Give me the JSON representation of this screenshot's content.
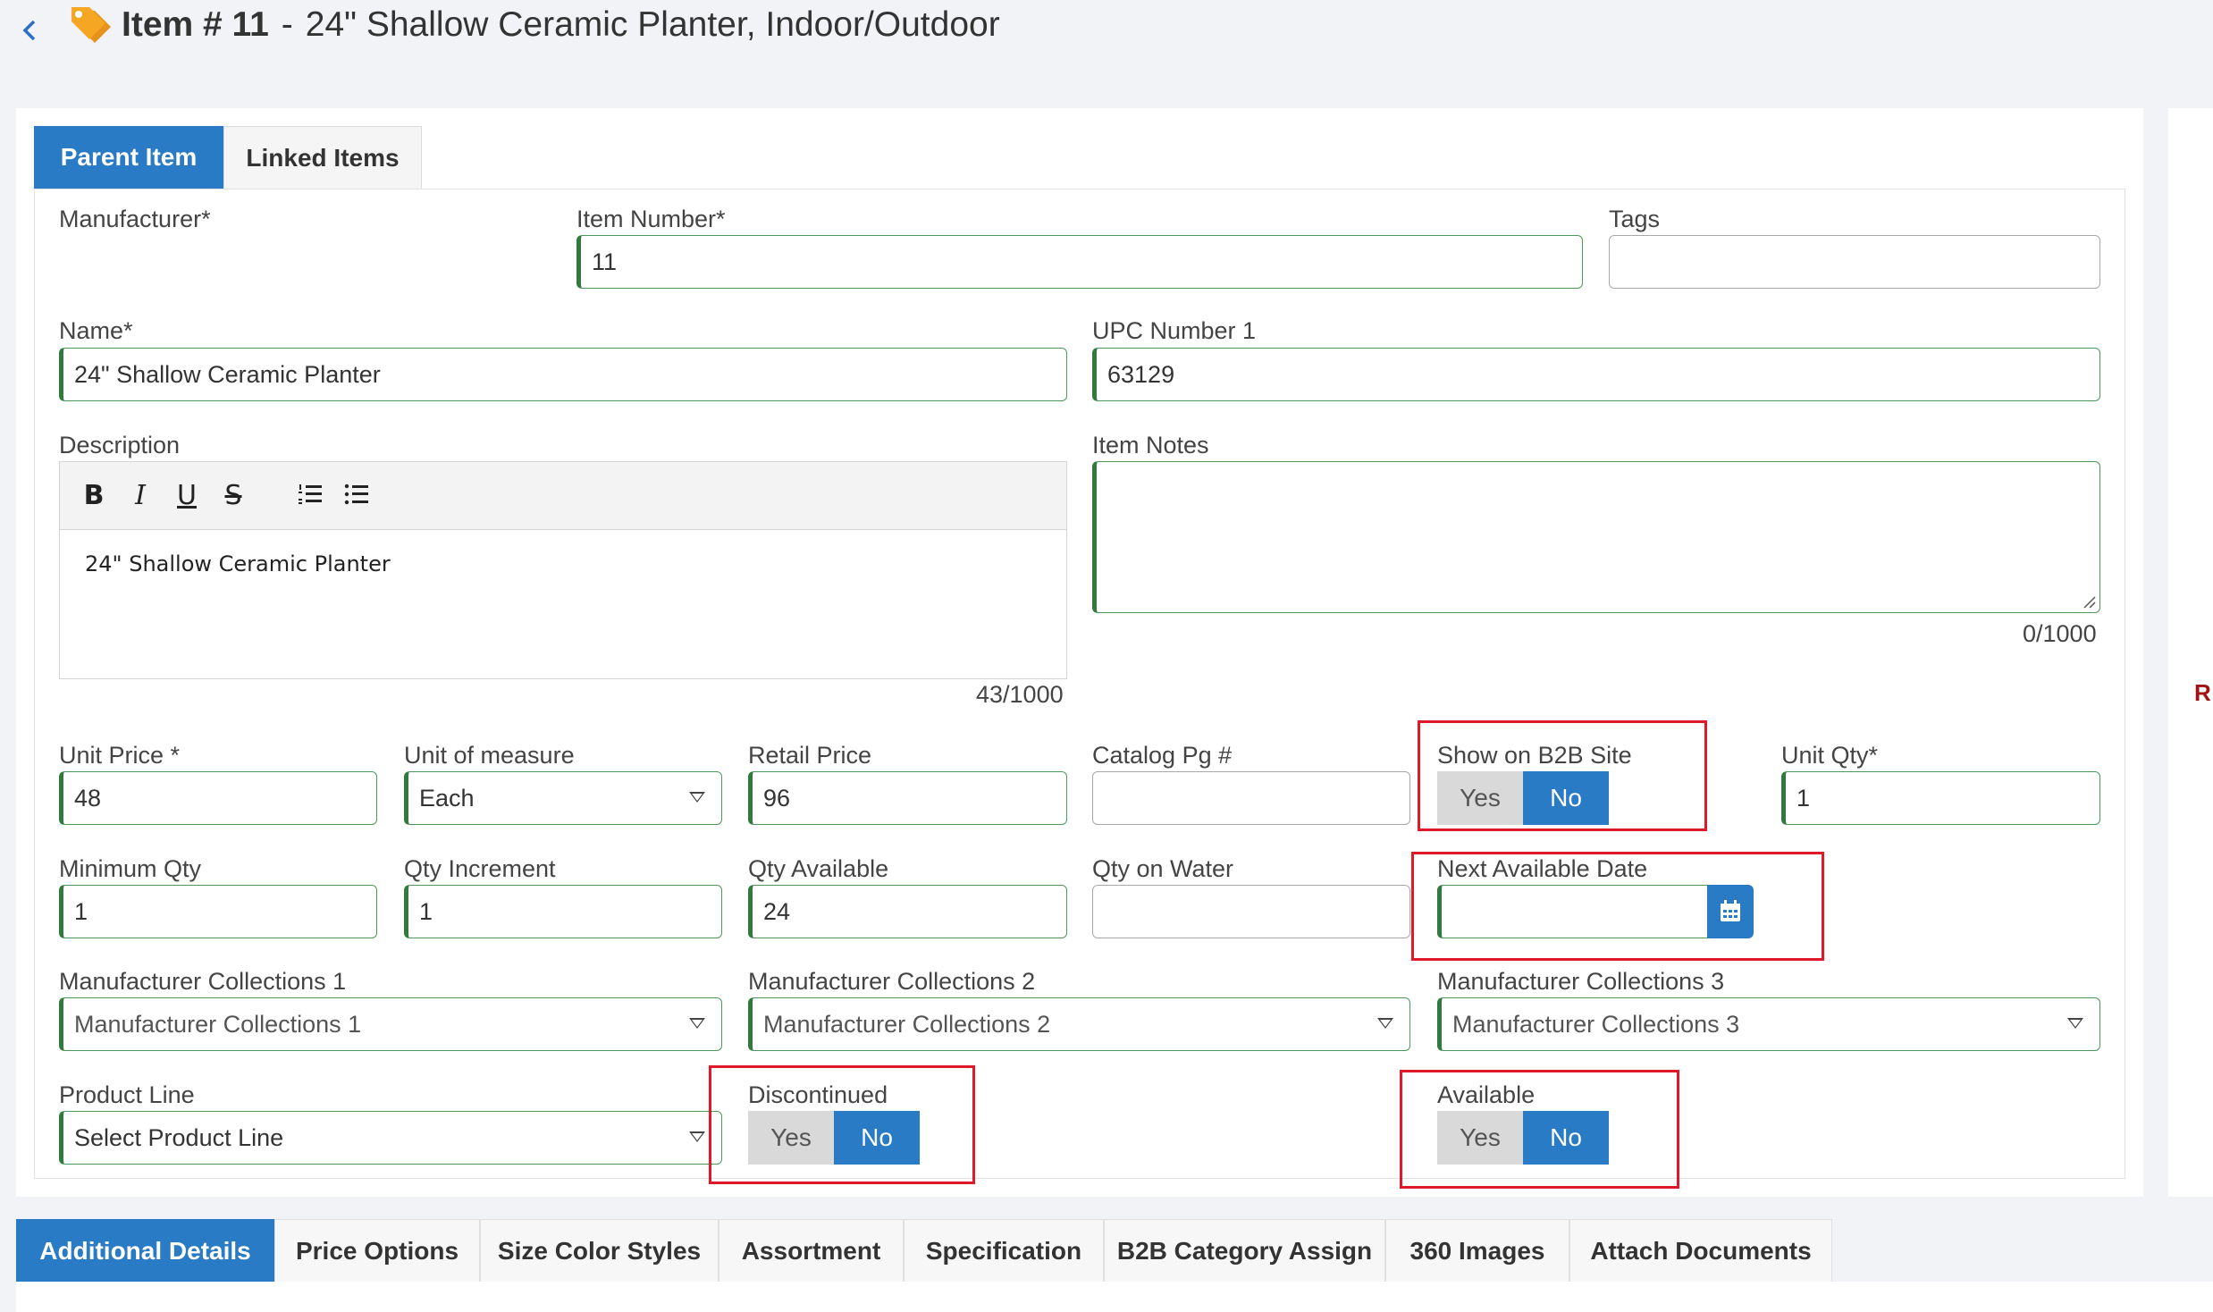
{
  "header": {
    "back_icon": "chevron-left-icon",
    "tag_icon": "price-tag-icon",
    "item_label": "Item # 11",
    "separator": "-",
    "title": "24\" Shallow Ceramic Planter, Indoor/Outdoor"
  },
  "top_tabs": [
    {
      "label": "Parent Item",
      "active": true
    },
    {
      "label": "Linked Items",
      "active": false
    }
  ],
  "form": {
    "manufacturer": {
      "label": "Manufacturer*"
    },
    "item_number": {
      "label": "Item Number*",
      "value": "11"
    },
    "tags": {
      "label": "Tags",
      "value": ""
    },
    "name": {
      "label": "Name*",
      "value": "24\" Shallow Ceramic Planter"
    },
    "upc": {
      "label": "UPC Number 1",
      "value": "63129"
    },
    "description": {
      "label": "Description",
      "value": "24\" Shallow Ceramic Planter",
      "counter": "43/1000",
      "toolbar": {
        "bold": "B",
        "italic": "I",
        "underline": "U",
        "strike": "S"
      }
    },
    "item_notes": {
      "label": "Item Notes",
      "value": "",
      "counter": "0/1000"
    },
    "unit_price": {
      "label": "Unit Price *",
      "value": "48"
    },
    "unit_of_measure": {
      "label": "Unit of measure",
      "value": "Each"
    },
    "retail_price": {
      "label": "Retail Price",
      "value": "96"
    },
    "catalog_pg": {
      "label": "Catalog Pg #",
      "value": ""
    },
    "show_b2b": {
      "label": "Show on B2B Site",
      "yes": "Yes",
      "no": "No",
      "selected": "No"
    },
    "unit_qty": {
      "label": "Unit Qty*",
      "value": "1"
    },
    "minimum_qty": {
      "label": "Minimum Qty",
      "value": "1"
    },
    "qty_increment": {
      "label": "Qty Increment",
      "value": "1"
    },
    "qty_available": {
      "label": "Qty Available",
      "value": "24"
    },
    "qty_on_water": {
      "label": "Qty on Water",
      "value": ""
    },
    "next_available_date": {
      "label": "Next Available Date",
      "value": "",
      "icon": "calendar-icon"
    },
    "mfr_collections_1": {
      "label": "Manufacturer Collections 1",
      "placeholder": "Manufacturer Collections 1"
    },
    "mfr_collections_2": {
      "label": "Manufacturer Collections 2",
      "placeholder": "Manufacturer Collections 2"
    },
    "mfr_collections_3": {
      "label": "Manufacturer Collections 3",
      "placeholder": "Manufacturer Collections 3"
    },
    "product_line": {
      "label": "Product Line",
      "placeholder": "Select Product Line"
    },
    "discontinued": {
      "label": "Discontinued",
      "yes": "Yes",
      "no": "No",
      "selected": "No"
    },
    "available": {
      "label": "Available",
      "yes": "Yes",
      "no": "No",
      "selected": "No"
    }
  },
  "right_panel": {
    "mark": "R"
  },
  "bottom_tabs": [
    {
      "label": "Additional Details",
      "active": true
    },
    {
      "label": "Price Options",
      "active": false
    },
    {
      "label": "Size Color Styles",
      "active": false
    },
    {
      "label": "Assortment",
      "active": false
    },
    {
      "label": "Specification",
      "active": false
    },
    {
      "label": "B2B Category Assign",
      "active": false
    },
    {
      "label": "360 Images",
      "active": false
    },
    {
      "label": "Attach Documents",
      "active": false
    }
  ],
  "colors": {
    "accent": "#2a7bc6",
    "valid_border": "#2f7a3c",
    "highlight_box": "#e0192a",
    "tag_icon": "#f5a623"
  }
}
